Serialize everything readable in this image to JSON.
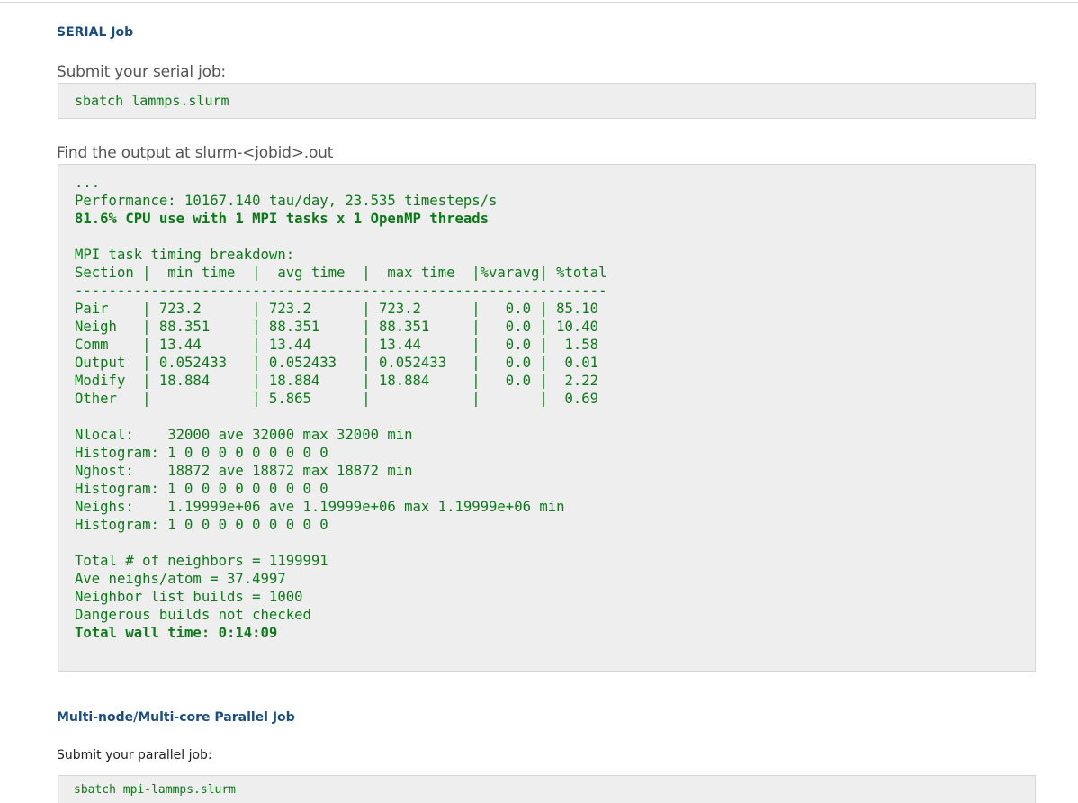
{
  "serial": {
    "heading": "SERIAL Job",
    "submit_text": "Submit your serial job:",
    "submit_command": "sbatch lammps.slurm",
    "output_text": "Find the output at slurm-<jobid>.out",
    "output_lines": [
      "...",
      "Performance: 10167.140 tau/day, 23.535 timesteps/s",
      "81.6% CPU use with 1 MPI tasks x 1 OpenMP threads",
      "",
      "MPI task timing breakdown:",
      "Section |  min time  |  avg time  |  max time  |%varavg| %total",
      "---------------------------------------------------------------",
      "Pair    | 723.2      | 723.2      | 723.2      |   0.0 | 85.10",
      "Neigh   | 88.351     | 88.351     | 88.351     |   0.0 | 10.40",
      "Comm    | 13.44      | 13.44      | 13.44      |   0.0 |  1.58",
      "Output  | 0.052433   | 0.052433   | 0.052433   |   0.0 |  0.01",
      "Modify  | 18.884     | 18.884     | 18.884     |   0.0 |  2.22",
      "Other   |            | 5.865      |            |       |  0.69",
      "",
      "Nlocal:    32000 ave 32000 max 32000 min",
      "Histogram: 1 0 0 0 0 0 0 0 0 0",
      "Nghost:    18872 ave 18872 max 18872 min",
      "Histogram: 1 0 0 0 0 0 0 0 0 0",
      "Neighs:    1.19999e+06 ave 1.19999e+06 max 1.19999e+06 min",
      "Histogram: 1 0 0 0 0 0 0 0 0 0",
      "",
      "Total # of neighbors = 1199991",
      "Ave neighs/atom = 37.4997",
      "Neighbor list builds = 1000",
      "Dangerous builds not checked",
      "Total wall time: 0:14:09"
    ]
  },
  "parallel": {
    "heading": "Multi-node/Multi-core Parallel Job",
    "submit_text": "Submit your parallel job:",
    "submit_command": "sbatch mpi-lammps.slurm"
  },
  "colors": {
    "heading": "#1a4d80",
    "code_text": "#0d7a1a",
    "code_background": "#eeeeee"
  }
}
